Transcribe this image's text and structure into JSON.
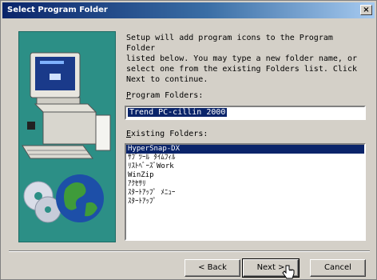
{
  "window": {
    "title": "Select Program Folder",
    "close_label": "×"
  },
  "description": "Setup will add program icons to the Program Folder\nlisted below.  You may type a new folder name, or\nselect one from the existing Folders list.  Click\nNext to continue.",
  "program_folders": {
    "label_prefix": "P",
    "label_rest": "rogram Folders:",
    "value": "Trend PC-cillin 2000"
  },
  "existing_folders": {
    "label_prefix": "E",
    "label_rest": "xisting Folders:",
    "items": [
      "HyperSnap-DX",
      "ｻﾌﾞﾂｰﾙ ﾀｲﾑﾌｨﾙ",
      "ﾘｽﾄﾍﾞｰｽﾞWork",
      "WinZip",
      "ｱｸｾｻﾘ",
      "ｽﾀｰﾄｱｯﾌﾟ ﾒﾆｭｰ",
      "ｽﾀｰﾄｱｯﾌﾟ"
    ],
    "selected_index": 0
  },
  "buttons": {
    "back": "< Back",
    "next": "Next >",
    "cancel": "Cancel"
  },
  "colors": {
    "art_background": "#2c8f86",
    "selection": "#0a246a",
    "title_gradient_start": "#0a246a"
  }
}
